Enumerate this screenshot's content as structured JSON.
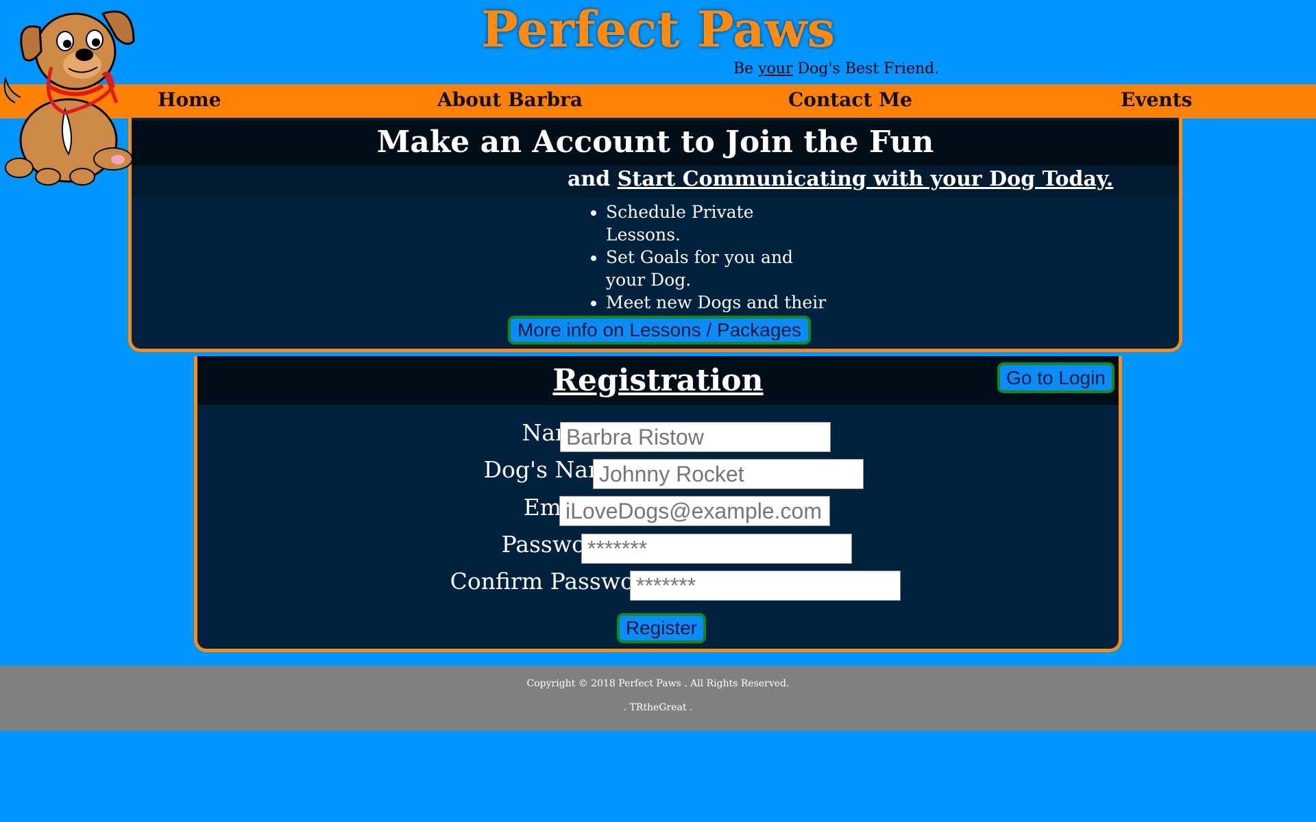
{
  "site": {
    "title": "Perfect Paws",
    "tagline_prefix": "Be ",
    "tagline_emphasis": "your",
    "tagline_suffix": " Dog's Best Friend."
  },
  "nav": {
    "items": [
      {
        "label": "Home"
      },
      {
        "label": "About Barbra"
      },
      {
        "label": "Contact Me"
      },
      {
        "label": "Events"
      }
    ]
  },
  "promo": {
    "title": "Make an Account to Join the Fun",
    "subtitle_prefix": "and ",
    "subtitle_link": "Start Communicating with your Dog Today.",
    "features": [
      "Schedule Private Lessons.",
      "Set Goals for you and your Dog.",
      "Meet new Dogs and their Owners."
    ],
    "info_button": "More info on Lessons / Packages"
  },
  "registration": {
    "title": "Registration",
    "login_button": "Go to Login",
    "fields": [
      {
        "label": "Name:",
        "placeholder": "Barbra Ristow"
      },
      {
        "label": "Dog's Name:",
        "placeholder": "Johnny Rocket"
      },
      {
        "label": "Email:",
        "placeholder": "iLoveDogs@example.com"
      },
      {
        "label": "Password:",
        "placeholder": "*******"
      },
      {
        "label": "Confirm Password:",
        "placeholder": "*******"
      }
    ],
    "register_button": "Register"
  },
  "footer": {
    "copyright": "Copyright © 2018 Perfect Paws . All Rights Reserved.",
    "credit": ". TRtheGreat ."
  },
  "colors": {
    "background": "#0096ff",
    "accent_orange": "#ff8207",
    "panel_navy": "#00223f",
    "button_blue": "#0a8bff",
    "button_border": "#118a1a",
    "footer_gray": "#808080"
  }
}
